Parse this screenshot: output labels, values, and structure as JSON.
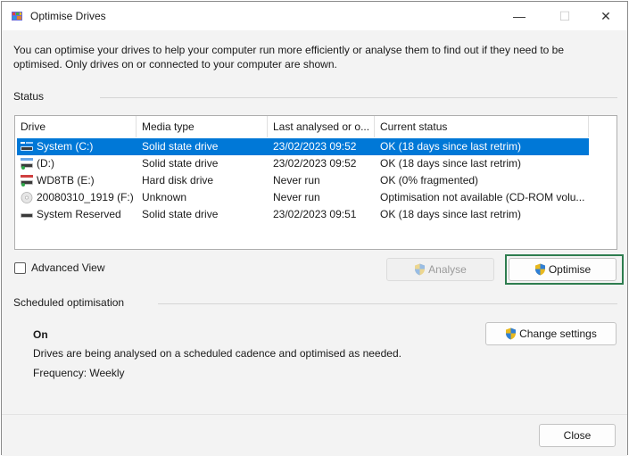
{
  "window": {
    "title": "Optimise Drives",
    "minimize_glyph": "—",
    "maximize_glyph": "☐",
    "close_glyph": "✕"
  },
  "intro": "You can optimise your drives to help your computer run more efficiently or analyse them to find out if they need to be optimised. Only drives on or connected to your computer are shown.",
  "status": {
    "label": "Status",
    "columns": [
      "Drive",
      "Media type",
      "Last analysed or o...",
      "Current status"
    ],
    "rows": [
      {
        "drive": "System (C:)",
        "media": "Solid state drive",
        "last": "23/02/2023 09:52",
        "status": "OK (18 days since last retrim)",
        "icon": "ssd-system-drive-icon",
        "selected": true
      },
      {
        "drive": "(D:)",
        "media": "Solid state drive",
        "last": "23/02/2023 09:52",
        "status": "OK (18 days since last retrim)",
        "icon": "ssd-drive-icon",
        "selected": false
      },
      {
        "drive": "WD8TB (E:)",
        "media": "Hard disk drive",
        "last": "Never run",
        "status": "OK (0% fragmented)",
        "icon": "hdd-drive-icon",
        "selected": false
      },
      {
        "drive": "20080310_1919 (F:)",
        "media": "Unknown",
        "last": "Never run",
        "status": "Optimisation not available (CD-ROM volu...",
        "icon": "cd-drive-icon",
        "selected": false
      },
      {
        "drive": "System Reserved",
        "media": "Solid state drive",
        "last": "23/02/2023 09:51",
        "status": "OK (18 days since last retrim)",
        "icon": "reserved-drive-icon",
        "selected": false
      }
    ]
  },
  "advanced_view_label": "Advanced View",
  "buttons": {
    "analyse": "Analyse",
    "optimise": "Optimise",
    "change_settings": "Change settings",
    "close": "Close"
  },
  "scheduled": {
    "label": "Scheduled optimisation",
    "state": "On",
    "description": "Drives are being analysed on a scheduled cadence and optimised as needed.",
    "frequency": "Frequency: Weekly"
  },
  "colors": {
    "selection": "#0078d7",
    "focus": "#2e7d4f"
  }
}
